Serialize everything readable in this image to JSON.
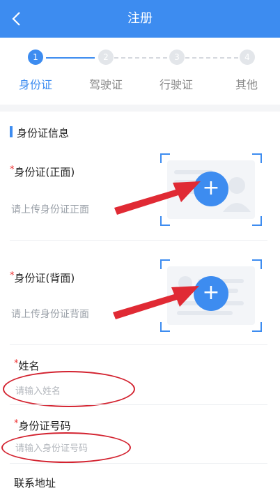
{
  "header": {
    "title": "注册"
  },
  "steps": [
    {
      "num": "1",
      "label": "身份证"
    },
    {
      "num": "2",
      "label": "驾驶证"
    },
    {
      "num": "3",
      "label": "行驶证"
    },
    {
      "num": "4",
      "label": "其他"
    }
  ],
  "section": {
    "title": "身份证信息"
  },
  "id_front": {
    "req": "*",
    "label": "身份证(正面)",
    "hint": "请上传身份证正面"
  },
  "id_back": {
    "req": "*",
    "label": "身份证(背面)",
    "hint": "请上传身份证背面"
  },
  "name": {
    "req": "*",
    "label": "姓名",
    "placeholder": "请输入姓名"
  },
  "id_number": {
    "req": "*",
    "label": "身份证号码",
    "placeholder": "请输入身份证号码"
  },
  "address": {
    "label": "联系地址"
  },
  "colors": {
    "accent": "#3d8cf0",
    "annotation": "#d32330"
  }
}
